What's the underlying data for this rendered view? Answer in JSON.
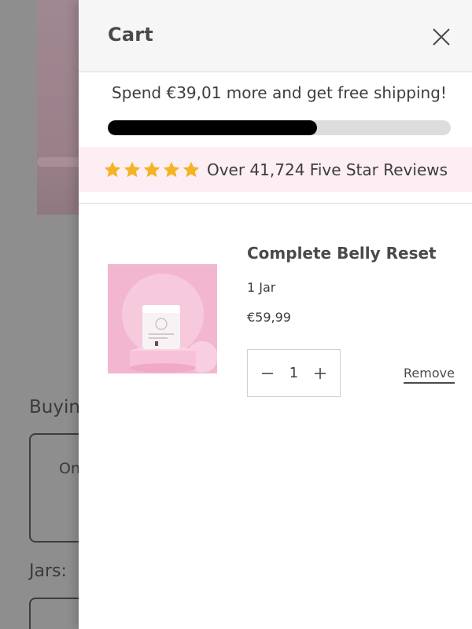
{
  "background": {
    "buying_label": "Buyin",
    "option_label": "On",
    "jars_label": "Jars:"
  },
  "cart": {
    "title": "Cart",
    "shipping_message": "Spend €39,01 more and get free shipping!",
    "shipping_progress_percent": 61,
    "reviews": {
      "star_count": 5,
      "text": "Over 41,724 Five Star Reviews"
    },
    "items": [
      {
        "name": "Complete Belly Reset",
        "variant": "1 Jar",
        "price": "€59,99",
        "quantity": "1",
        "remove_label": "Remove"
      }
    ]
  },
  "colors": {
    "progress_fill": "#000000",
    "progress_track": "#dddddd",
    "star": "#f5b324",
    "reviews_background": "#fdeef4",
    "product_pink": "#f3b6d0"
  },
  "icons": {
    "close": "close-icon",
    "star": "star-icon",
    "minus": "minus-icon",
    "plus": "plus-icon"
  }
}
